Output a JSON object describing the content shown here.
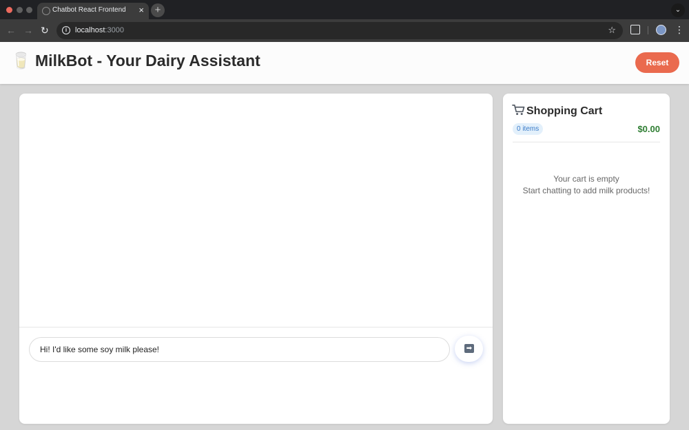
{
  "browser": {
    "tab_title": "Chatbot React Frontend",
    "tab_close": "×",
    "new_tab": "+",
    "tab_menu": "⌄",
    "url_host": "localhost",
    "url_port": ":3000"
  },
  "app": {
    "title": "🥛 MilkBot - Your Dairy Assistant",
    "reset_label": "Reset"
  },
  "chat": {
    "input_value": "Hi! I'd like some soy milk please!",
    "send_icon": "➡"
  },
  "cart": {
    "title": "Shopping Cart",
    "items_count": "0 items",
    "total": "$0.00",
    "empty_line1": "Your cart is empty",
    "empty_line2": "Start chatting to add milk products!"
  },
  "colors": {
    "reset_button": "#ea6a4e",
    "total_green": "#2e7d32",
    "badge_blue": "#3a7bc8"
  }
}
